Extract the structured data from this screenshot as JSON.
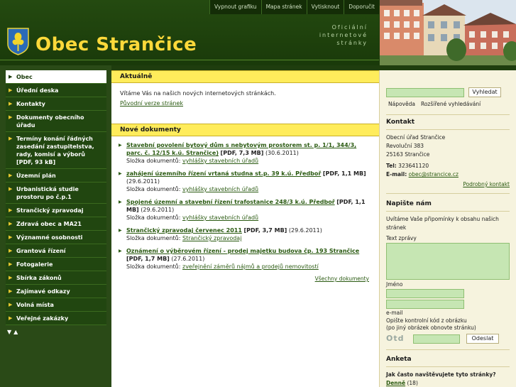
{
  "topnav": [
    "Vypnout grafiku",
    "Mapa stránek",
    "Vytisknout",
    "Doporučit"
  ],
  "site": {
    "title": "Obec Strančice",
    "slogan": [
      "Oficiální",
      "internetové",
      "stránky"
    ]
  },
  "menu": [
    {
      "label": "Obec",
      "active": true
    },
    {
      "label": "Úřední deska"
    },
    {
      "label": "Kontakty"
    },
    {
      "label": "Dokumenty obecního úřadu"
    },
    {
      "label": "Termíny konání řádných zasedání zastupitelstva, rady, komisí a výborů [PDF, 93 kB]"
    },
    {
      "label": "Územní plán"
    },
    {
      "label": "Urbanistická studie prostoru po č.p.1"
    },
    {
      "label": "Strančický zpravodaj"
    },
    {
      "label": "Zdravá obec a MA21"
    },
    {
      "label": "Významné osobnosti"
    },
    {
      "label": "Grantová řízení"
    },
    {
      "label": "Fotogalerie"
    },
    {
      "label": "Sbírka zákonů"
    },
    {
      "label": "Zajímavé odkazy"
    },
    {
      "label": "Volná místa"
    },
    {
      "label": "Veřejné zakázky"
    }
  ],
  "aktualne": {
    "title": "Aktuálně",
    "text": "Vítáme Vás na našich nových internetových stránkách.",
    "link": "Původní verze stránek"
  },
  "nove": {
    "title": "Nové dokumenty",
    "folder_label": "Složka dokumentů:",
    "docs": [
      {
        "title": "Stavební povolení bytový dům s nebytovým prostorem st. p. 1/1, 344/3, parc. č. 12/15 k.ú. Strančice)",
        "meta": "[PDF, 7,3 MB]",
        "date": "(30.6.2011)",
        "folder": "vyhlášky stavebních úřadů"
      },
      {
        "title": "zahájení územního řízení vrtaná studna st.p. 39 k.ú. Předboř",
        "meta": "[PDF, 1,1 MB]",
        "date": "(29.6.2011)",
        "folder": "vyhlášky stavebních úřadů"
      },
      {
        "title": "Spojené územní a stavební řízení trafostanice 248/3 k.ú. Předboř",
        "meta": "[PDF, 1,1 MB]",
        "date": "(29.6.2011)",
        "folder": "vyhlášky stavebních úřadů"
      },
      {
        "title": "Strančický zpravodaj červenec 2011",
        "meta": "[PDF, 3,7 MB]",
        "date": "(29.6.2011)",
        "folder": "Strančický zpravodaj"
      },
      {
        "title": "Oznámení o výběrovém řízení - prodej majetku budova čp. 193 Strančice",
        "meta": "[PDF, 1,7 MB]",
        "date": "(27.6.2011)",
        "folder": "zveřejnění záměrů nájmů a prodejů nemovitostí"
      }
    ],
    "all": "Všechny dokumenty"
  },
  "search": {
    "button": "Vyhledat",
    "help": "Nápověda",
    "advanced": "Rozšířené vyhledávání"
  },
  "contact": {
    "title": "Kontakt",
    "lines": [
      "Obecní úřad Strančice",
      "Revoluční 383",
      "25163 Strančice"
    ],
    "tel_label": "Tel:",
    "tel": "323641120",
    "email_label": "E-mail:",
    "email": "obec@strancice.cz",
    "more": "Podrobný kontakt"
  },
  "write": {
    "title": "Napište nám",
    "intro": "Uvítáme Vaše připomínky k obsahu našich stránek",
    "message_label": "Text zprávy",
    "name_label": "Jméno",
    "email_label": "e-mail",
    "captcha_label": "Opište kontrolní kód z obrázku",
    "captcha_hint": "(po jiný obrázek obnovte stránku)",
    "captcha_code": "Otd",
    "send": "Odeslat"
  },
  "poll": {
    "title": "Anketa",
    "question": "Jak často navštěvujete tyto stránky?",
    "option": "Denně",
    "count": "(18)"
  }
}
